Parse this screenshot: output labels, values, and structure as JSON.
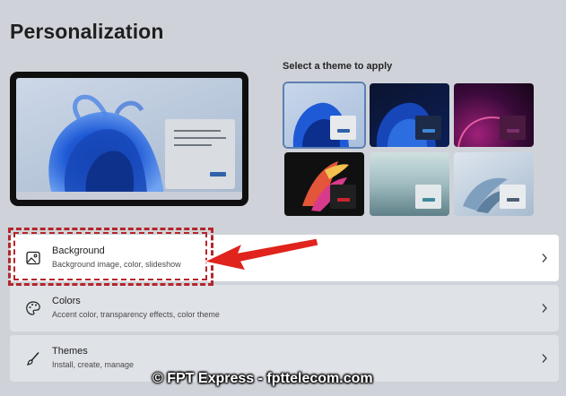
{
  "page": {
    "title": "Personalization"
  },
  "themes": {
    "heading": "Select a theme to apply",
    "tiles": [
      {
        "name": "windows-light",
        "selected": true
      },
      {
        "name": "windows-dark",
        "selected": false
      },
      {
        "name": "glow",
        "selected": false
      },
      {
        "name": "captured-motion",
        "selected": false
      },
      {
        "name": "sunrise",
        "selected": false
      },
      {
        "name": "flow",
        "selected": false
      }
    ]
  },
  "settings": {
    "background": {
      "title": "Background",
      "subtitle": "Background image, color, slideshow",
      "icon": "image-icon"
    },
    "colors": {
      "title": "Colors",
      "subtitle": "Accent color, transparency effects, color theme",
      "icon": "palette-icon"
    },
    "themes": {
      "title": "Themes",
      "subtitle": "Install, create, manage",
      "icon": "brush-icon"
    }
  },
  "annotation": {
    "highlight_color": "#b3262b",
    "arrow_color": "#e0231c"
  },
  "watermark": {
    "text": "© FPT Express - fpttelecom.com"
  }
}
